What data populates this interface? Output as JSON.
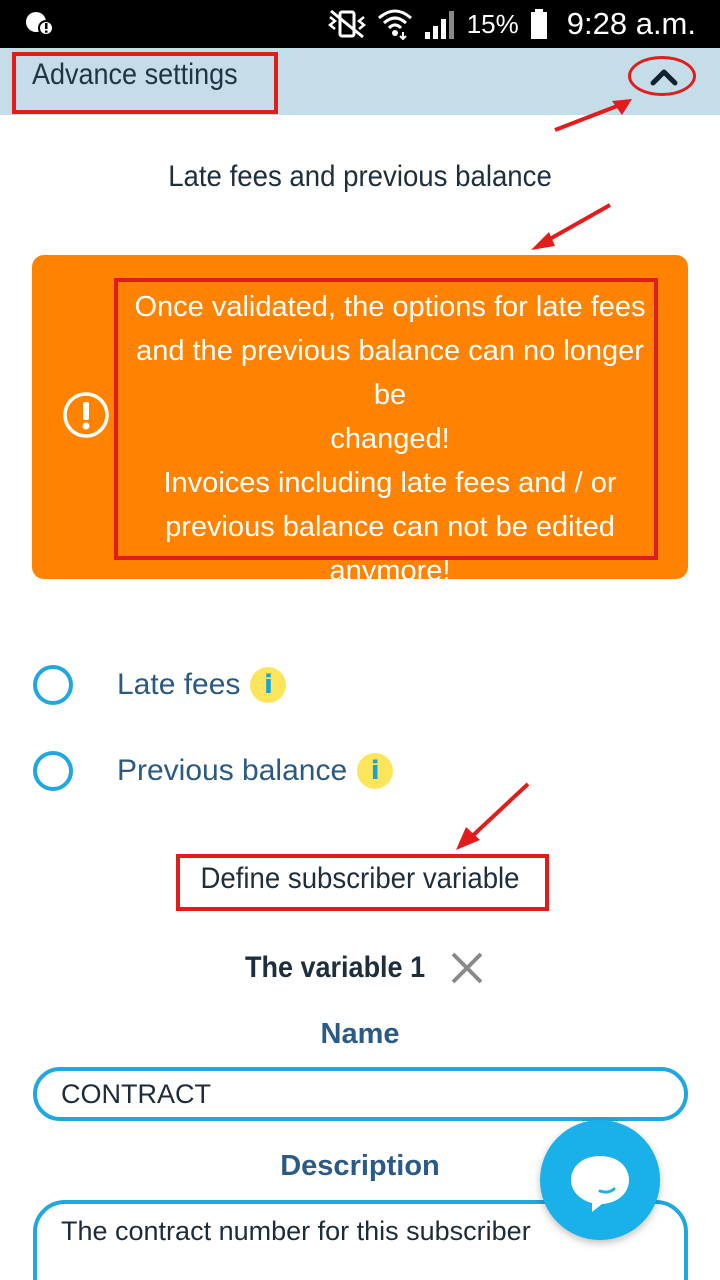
{
  "status_bar": {
    "battery_percent": "15%",
    "time": "9:28 a.m."
  },
  "header": {
    "title": "Advance settings",
    "toggle_icon": "chevron-up-icon"
  },
  "late_fees_section": {
    "title": "Late fees and previous balance",
    "warning": {
      "icon": "exclamation-circle-icon",
      "line1": "Once validated, the options for late fees",
      "line2": "and the previous balance can no longer be",
      "line3": "changed!",
      "line4": "Invoices including late fees and / or",
      "line5": "previous balance can not be edited",
      "line6": "anymore!"
    },
    "options": [
      {
        "label": "Late fees",
        "info": "i"
      },
      {
        "label": "Previous balance",
        "info": "i"
      }
    ]
  },
  "subscriber_variable": {
    "title": "Define subscriber variable",
    "variable_title": "The variable 1",
    "name_label": "Name",
    "name_value": "CONTRACT",
    "description_label": "Description",
    "description_value": "The contract number for this  subscriber"
  },
  "colors": {
    "header_bg": "#c5dde8",
    "warning_bg": "#ff8300",
    "accent": "#20a7dd",
    "annotation_red": "#e21b1b",
    "info_badge": "#fce55a"
  }
}
